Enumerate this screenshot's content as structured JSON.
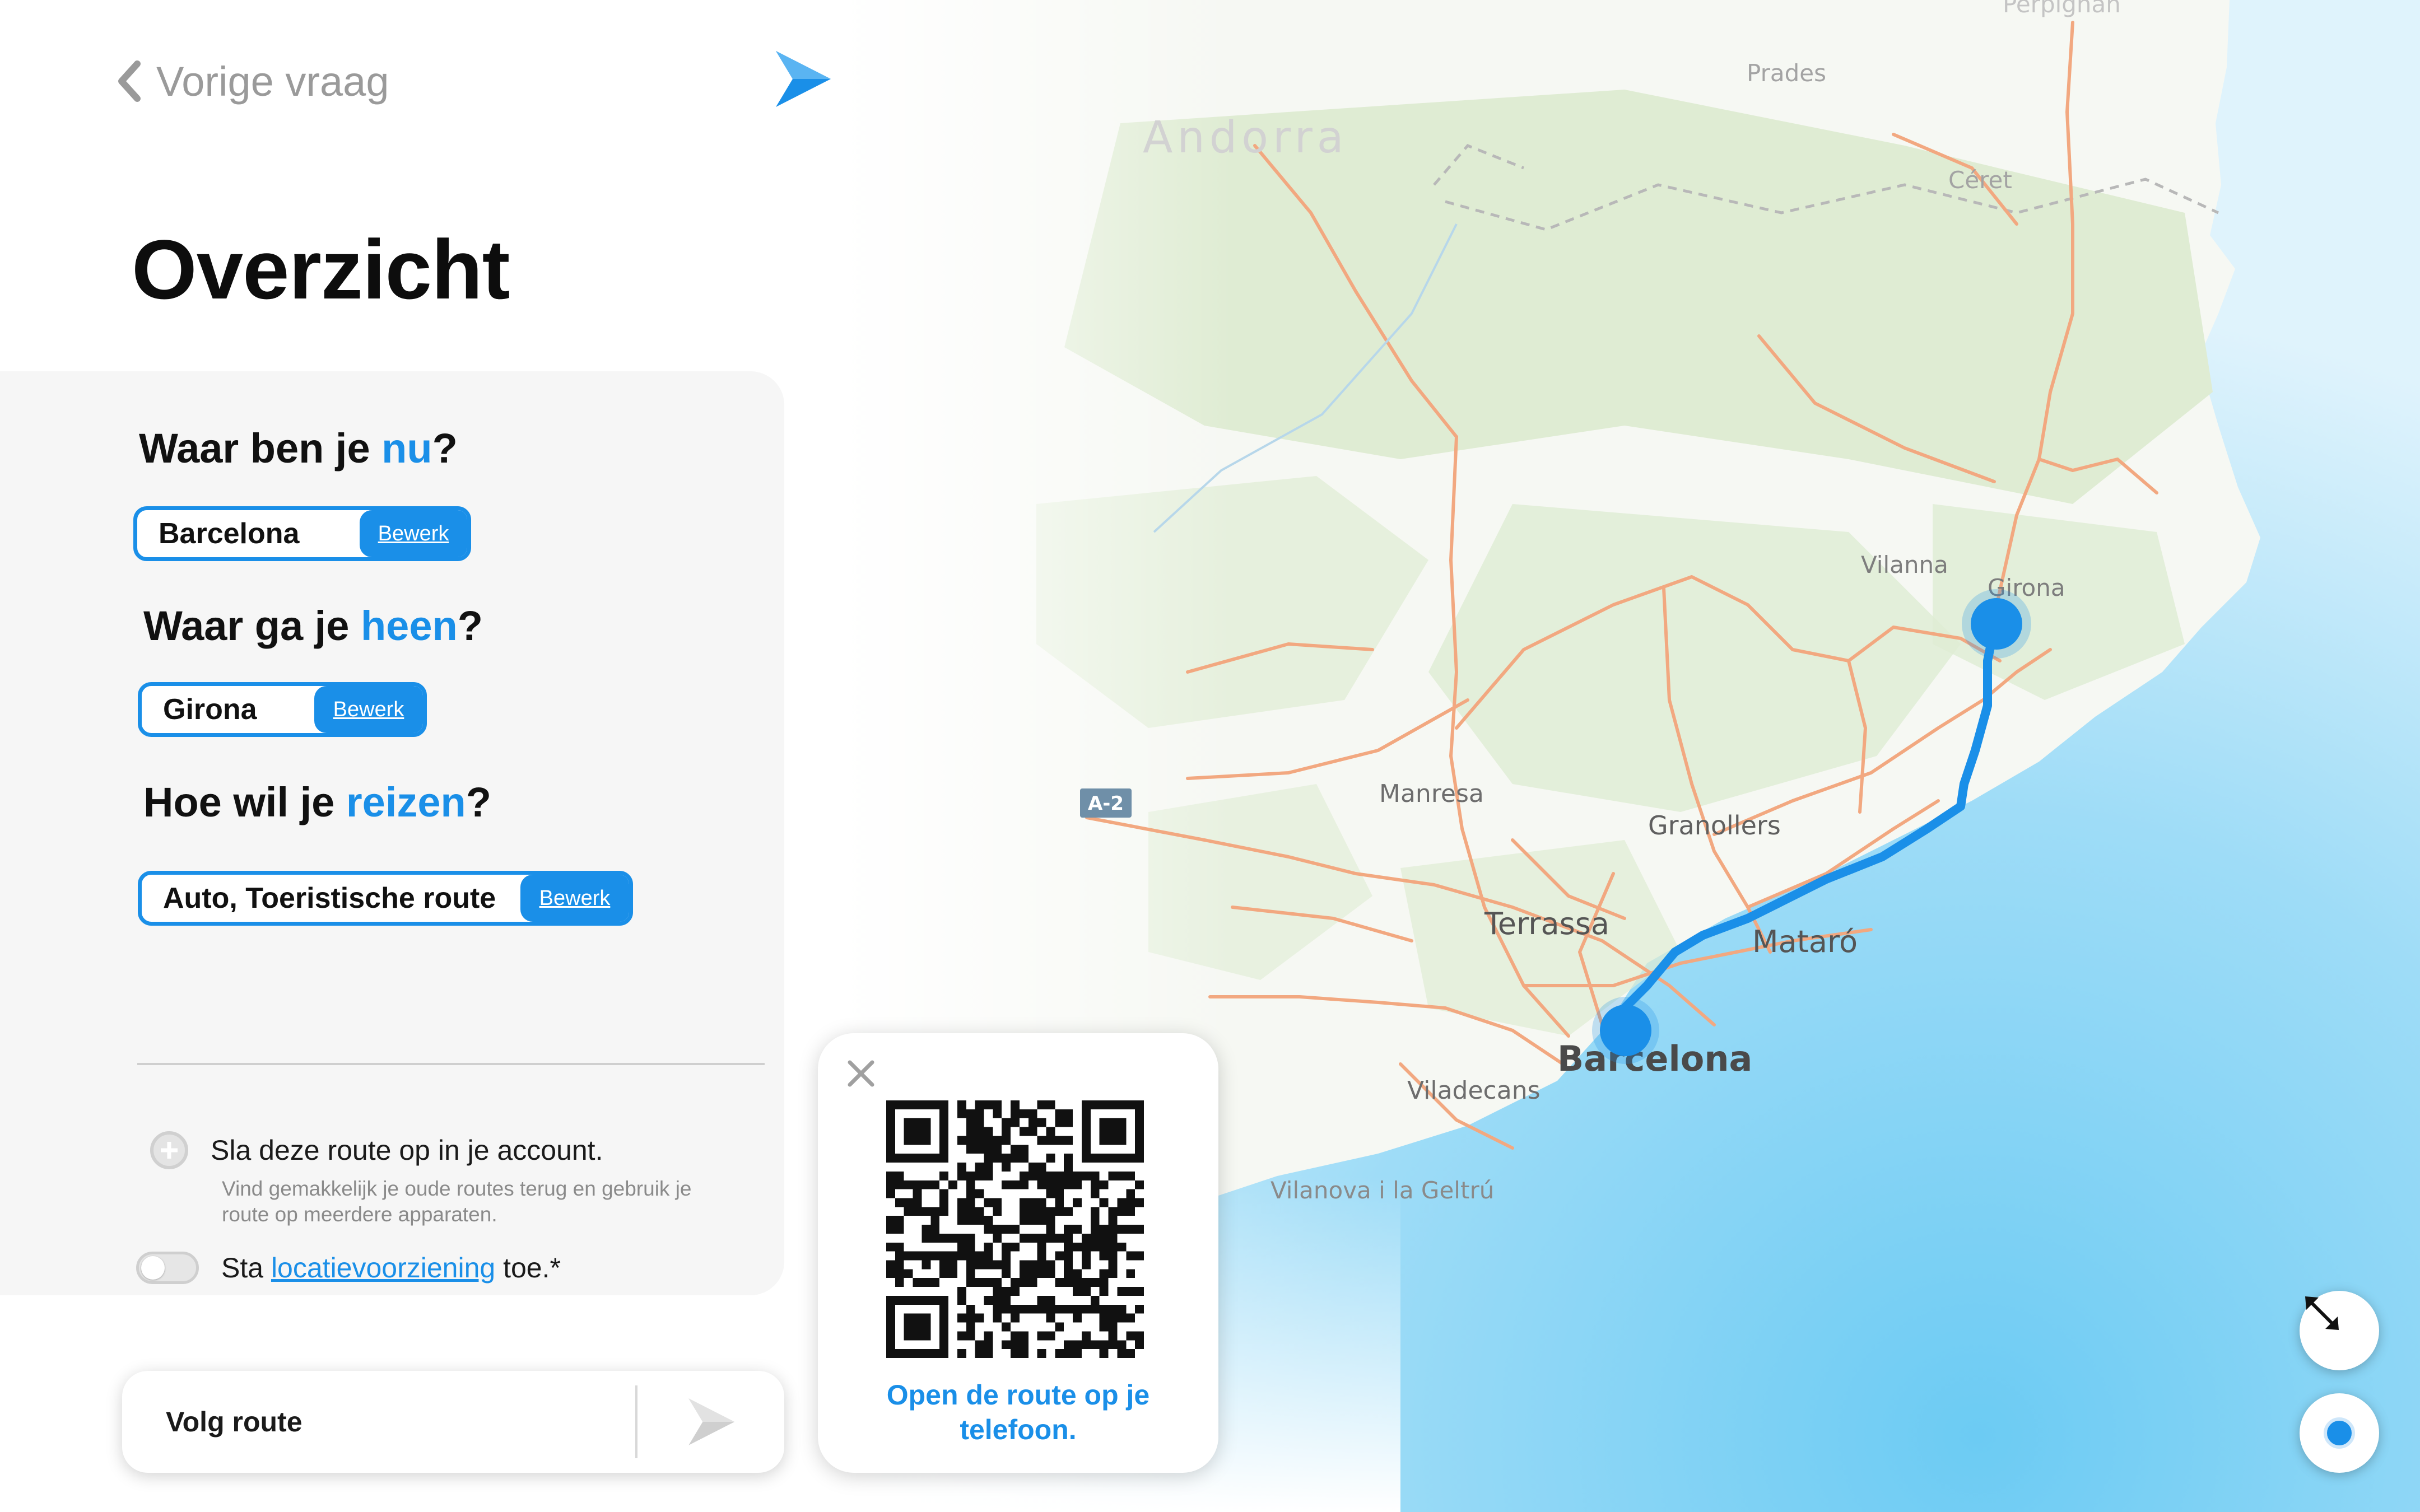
{
  "nav": {
    "back_label": "Vorige vraag"
  },
  "page": {
    "title": "Overzicht"
  },
  "form": {
    "q_from": {
      "prefix": "Waar ben je ",
      "highlight": "nu",
      "suffix": "?"
    },
    "from_value": "Barcelona",
    "q_to": {
      "prefix": "Waar ga je ",
      "highlight": "heen",
      "suffix": "?"
    },
    "to_value": "Girona",
    "q_mode": {
      "prefix": "Hoe wil je ",
      "highlight": "reizen",
      "suffix": "?"
    },
    "mode_value": "Auto, Toeristische route",
    "edit_label": "Bewerk"
  },
  "save": {
    "title": "Sla deze route op in je account.",
    "subtitle": "Vind gemakkelijk je oude routes terug en gebruik je route op meerdere apparaten."
  },
  "location": {
    "prefix": "Sta ",
    "link": "locatievoorziening",
    "suffix": " toe.*"
  },
  "follow": {
    "label": "Volg route"
  },
  "qr": {
    "text": "Open de route op je telefoon."
  },
  "map": {
    "labels": {
      "perpignan": "Perpignan",
      "prades": "Prades",
      "andorra": "Andorra",
      "ceret": "Céret",
      "vilanna": "Vilanna",
      "girona": "Girona",
      "a2": "A-2",
      "manresa": "Manresa",
      "granollers": "Granollers",
      "terrassa": "Terrassa",
      "mataro": "Mataró",
      "barcelona": "Barcelona",
      "viladecans": "Viladecans",
      "vilanova": "Vilanova i la Geltrú"
    }
  },
  "colors": {
    "accent": "#1a8fe8",
    "sea": "#7fd3f5",
    "land_green": "#e3efd9",
    "road": "#f2a880",
    "route": "#1a8fe8"
  },
  "icons": {
    "back": "chevron-left-icon",
    "logo": "logo-icon",
    "plus": "plus-icon",
    "follow": "navigation-arrow-icon",
    "close": "close-icon",
    "expand": "expand-icon",
    "locate": "locate-icon"
  }
}
